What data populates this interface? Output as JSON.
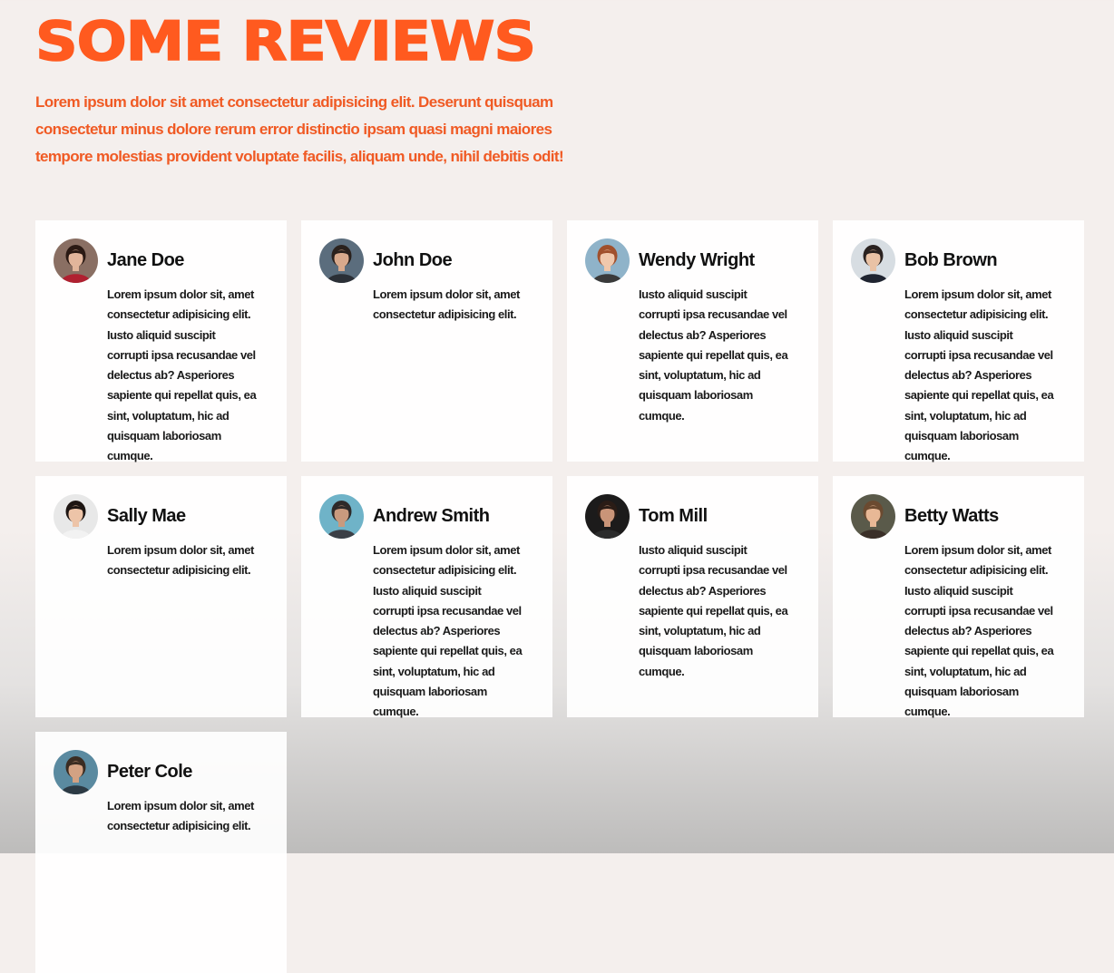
{
  "page": {
    "title": "SOME REVIEWS",
    "intro": "Lorem ipsum dolor sit amet consectetur adipisicing elit. Deserunt quisquam consectetur minus dolore rerum error distinctio ipsam quasi magni maiores tempore molestias provident voluptate facilis, aliquam unde, nihil debitis odit!",
    "accent_color": "#ff5a1f"
  },
  "reviews": [
    {
      "name": "Jane Doe",
      "text": "Lorem ipsum dolor sit, amet consectetur adipisicing elit. Iusto aliquid suscipit corrupti ipsa recusandae vel delectus ab? Asperiores sapiente qui repellat quis, ea sint, voluptatum, hic ad quisquam laboriosam cumque.",
      "avatar": {
        "bg": "#8a6f63",
        "skin": "#e2b59b",
        "hair": "#2b1a14",
        "shirt": "#b02030"
      }
    },
    {
      "name": "John Doe",
      "text": "Lorem ipsum dolor sit, amet consectetur adipisicing elit.",
      "avatar": {
        "bg": "#5b6d7d",
        "skin": "#d8a98c",
        "hair": "#2a211d",
        "shirt": "#2b2f36"
      }
    },
    {
      "name": "Wendy Wright",
      "text": "Iusto aliquid suscipit corrupti ipsa recusandae vel delectus ab? Asperiores sapiente qui repellat quis, ea sint, voluptatum, hic ad quisquam laboriosam cumque.",
      "avatar": {
        "bg": "#8fb3c9",
        "skin": "#f0c8ac",
        "hair": "#a0502c",
        "shirt": "#3a3a3a"
      }
    },
    {
      "name": "Bob Brown",
      "text": "Lorem ipsum dolor sit, amet consectetur adipisicing elit. Iusto aliquid suscipit corrupti ipsa recusandae vel delectus ab? Asperiores sapiente qui repellat quis, ea sint, voluptatum, hic ad quisquam laboriosam cumque.",
      "avatar": {
        "bg": "#d7dde2",
        "skin": "#e9c2a5",
        "hair": "#2a2220",
        "shirt": "#1f2430"
      }
    },
    {
      "name": "Sally Mae",
      "text": "Lorem ipsum dolor sit, amet consectetur adipisicing elit.",
      "avatar": {
        "bg": "#e8e8e8",
        "skin": "#edc4a8",
        "hair": "#1d1512",
        "shirt": "#f2f2f2"
      }
    },
    {
      "name": "Andrew Smith",
      "text": "Lorem ipsum dolor sit, amet consectetur adipisicing elit. Iusto aliquid suscipit corrupti ipsa recusandae vel delectus ab? Asperiores sapiente qui repellat quis, ea sint, voluptatum, hic ad quisquam laboriosam cumque.",
      "avatar": {
        "bg": "#6fb3c8",
        "skin": "#c99a7e",
        "hair": "#2e2a2a",
        "shirt": "#3b3f46"
      }
    },
    {
      "name": "Tom Mill",
      "text": "Iusto aliquid suscipit corrupti ipsa recusandae vel delectus ab? Asperiores sapiente qui repellat quis, ea sint, voluptatum, hic ad quisquam laboriosam cumque.",
      "avatar": {
        "bg": "#1c1b1b",
        "skin": "#c99478",
        "hair": "#2a1c16",
        "shirt": "#2c2c2c"
      }
    },
    {
      "name": "Betty Watts",
      "text": "Lorem ipsum dolor sit, amet consectetur adipisicing elit. Iusto aliquid suscipit corrupti ipsa recusandae vel delectus ab? Asperiores sapiente qui repellat quis, ea sint, voluptatum, hic ad quisquam laboriosam cumque.",
      "avatar": {
        "bg": "#5a5a4a",
        "skin": "#e8b896",
        "hair": "#6b4a30",
        "shirt": "#3a2f28"
      }
    },
    {
      "name": "Peter Cole",
      "text": "Lorem ipsum dolor sit, amet consectetur adipisicing elit.",
      "avatar": {
        "bg": "#5a8aa0",
        "skin": "#d3a283",
        "hair": "#3a2c22",
        "shirt": "#2c3a44"
      }
    }
  ]
}
